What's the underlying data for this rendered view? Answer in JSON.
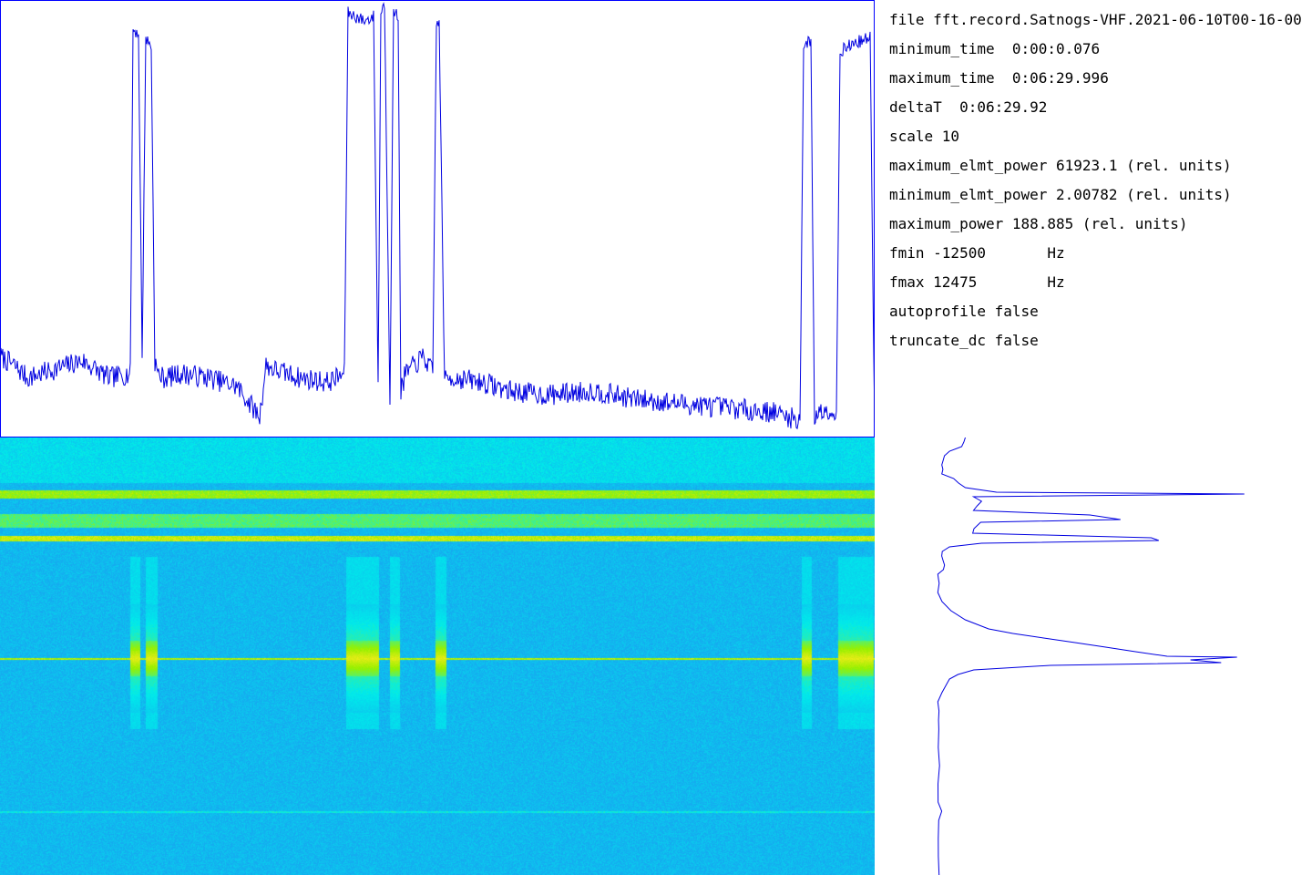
{
  "info": {
    "file": "file fft.record.Satnogs-VHF.2021-06-10T00-16-00",
    "minimum_time": "minimum_time  0:00:0.076",
    "maximum_time": "maximum_time  0:06:29.996",
    "deltaT": "deltaT  0:06:29.92",
    "scale": "scale 10",
    "maximum_elmt_power": "maximum_elmt_power 61923.1 (rel. units)",
    "minimum_elmt_power": "minimum_elmt_power 2.00782 (rel. units)",
    "maximum_power": "maximum_power 188.885 (rel. units)",
    "fmin": "fmin -12500       Hz",
    "fmax": "fmax 12475        Hz",
    "autoprofile": "autoprofile false",
    "truncate_dc": "truncate_dc false"
  },
  "colors": {
    "trace": "#0000e0",
    "frame": "#0000ff",
    "spectrogram_background": "#13c3ee",
    "carrier_line": "#7ef000",
    "signal_burst": "#ffee22"
  },
  "chart_data": [
    {
      "type": "line",
      "series": [
        {
          "x": [
            0,
            15,
            30,
            60,
            90,
            120,
            143,
            146,
            152,
            156,
            160,
            166,
            170,
            173,
            180,
            200,
            230,
            260,
            285,
            292,
            300,
            330,
            360,
            378,
            382,
            390,
            400,
            410,
            415,
            418,
            422,
            428,
            432,
            437,
            440,
            445,
            455,
            465,
            475,
            479,
            482,
            488,
            492,
            500,
            530,
            560,
            600,
            650,
            700,
            750,
            800,
            850,
            878,
            882,
            886,
            890,
            894,
            900,
            910,
            918,
            922,
            930,
            940,
            955,
            960
          ],
          "y": [
            18,
            16,
            13,
            15,
            17,
            13,
            14,
            94,
            93,
            18,
            92,
            90,
            17,
            14,
            13,
            14,
            13,
            11,
            4,
            16,
            15,
            13,
            12,
            14,
            98,
            97,
            96,
            97,
            11,
            98,
            100,
            9,
            98,
            97,
            10,
            14,
            16,
            18,
            14,
            96,
            95,
            12,
            13,
            13,
            12,
            10,
            9,
            10,
            8,
            7,
            6,
            5,
            3,
            90,
            91,
            91,
            4,
            5,
            6,
            4,
            89,
            90,
            91,
            92,
            1
          ]
        }
      ],
      "ylim": [
        0,
        100
      ],
      "grid": false
    },
    {
      "type": "heatmap",
      "colormap": "cyan-green-yellow",
      "carrier_line_color": "#7ef000",
      "signal_bursts": [
        {
          "t_start": 143,
          "t_end": 153
        },
        {
          "t_start": 160,
          "t_end": 172
        },
        {
          "t_start": 380,
          "t_end": 415
        },
        {
          "t_start": 428,
          "t_end": 438
        },
        {
          "t_start": 478,
          "t_end": 489
        },
        {
          "t_start": 880,
          "t_end": 890
        },
        {
          "t_start": 920,
          "t_end": 958
        }
      ]
    },
    {
      "type": "line",
      "orientation": "vertical",
      "series": [
        {
          "freq_index": [
            0,
            5,
            10,
            15,
            20,
            25,
            30,
            35,
            40,
            45,
            50,
            55,
            60,
            62,
            65,
            70,
            75,
            80,
            85,
            90,
            93,
            96,
            100,
            105,
            110,
            113,
            116,
            120,
            125,
            130,
            135,
            140,
            145,
            150,
            155,
            160,
            170,
            180,
            190,
            200,
            210,
            215,
            220,
            225,
            230,
            235,
            240,
            241,
            244,
            247,
            250,
            255,
            260,
            265,
            270,
            280,
            290,
            300,
            310,
            320,
            340,
            360,
            380,
            400,
            410,
            420,
            440,
            460,
            480
          ],
          "power": [
            40,
            38,
            35,
            20,
            12,
            10,
            10,
            10,
            10,
            25,
            30,
            40,
            80,
            400,
            50,
            60,
            55,
            50,
            200,
            240,
            60,
            55,
            50,
            50,
            280,
            290,
            60,
            20,
            10,
            8,
            10,
            12,
            10,
            5,
            5,
            5,
            5,
            10,
            20,
            40,
            70,
            100,
            140,
            180,
            220,
            260,
            300,
            390,
            330,
            370,
            150,
            50,
            30,
            20,
            15,
            10,
            5,
            5,
            5,
            5,
            5,
            5,
            5,
            5,
            10,
            5,
            5,
            5,
            5
          ]
        }
      ],
      "xlim": [
        0,
        480
      ],
      "ylim": [
        0,
        480
      ]
    }
  ]
}
